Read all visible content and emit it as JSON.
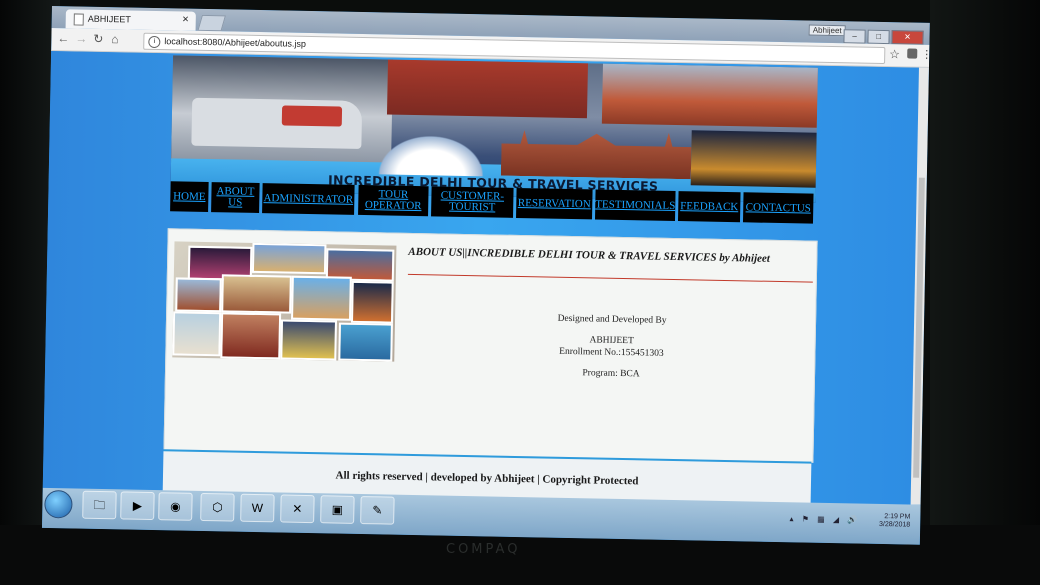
{
  "browser": {
    "tab_title": "ABHIJEET",
    "url": "localhost:8080/Abhijeet/aboutus.jsp",
    "user_badge": "Abhijeet",
    "win_min": "–",
    "win_max": "□",
    "win_close": "✕"
  },
  "banner": {
    "title": "INCREDIBLE DELHI TOUR & TRAVEL SERVICES"
  },
  "nav": {
    "items": [
      {
        "label": "HOME"
      },
      {
        "label": "ABOUT US"
      },
      {
        "label": "ADMINISTRATOR"
      },
      {
        "label": "TOUR OPERATOR"
      },
      {
        "label": "CUSTOMER-TOURIST"
      },
      {
        "label": "RESERVATION"
      },
      {
        "label": "TESTIMONIALS"
      },
      {
        "label": "FEEDBACK"
      },
      {
        "label": "CONTACTUS"
      }
    ]
  },
  "content": {
    "heading": "ABOUT US||INCREDIBLE DELHI TOUR & TRAVEL SERVICES by Abhijeet",
    "designed_by": "Designed and Developed By",
    "name": "ABHIJEET",
    "enrollment": "Enrollment No.:155451303",
    "program": "Program: BCA"
  },
  "footer": {
    "text": "All rights reserved | developed by Abhijeet | Copyright Protected"
  },
  "taskbar": {
    "time": "2:19 PM",
    "date": "3/28/2018"
  },
  "monitor": {
    "brand": "COMPAQ"
  }
}
